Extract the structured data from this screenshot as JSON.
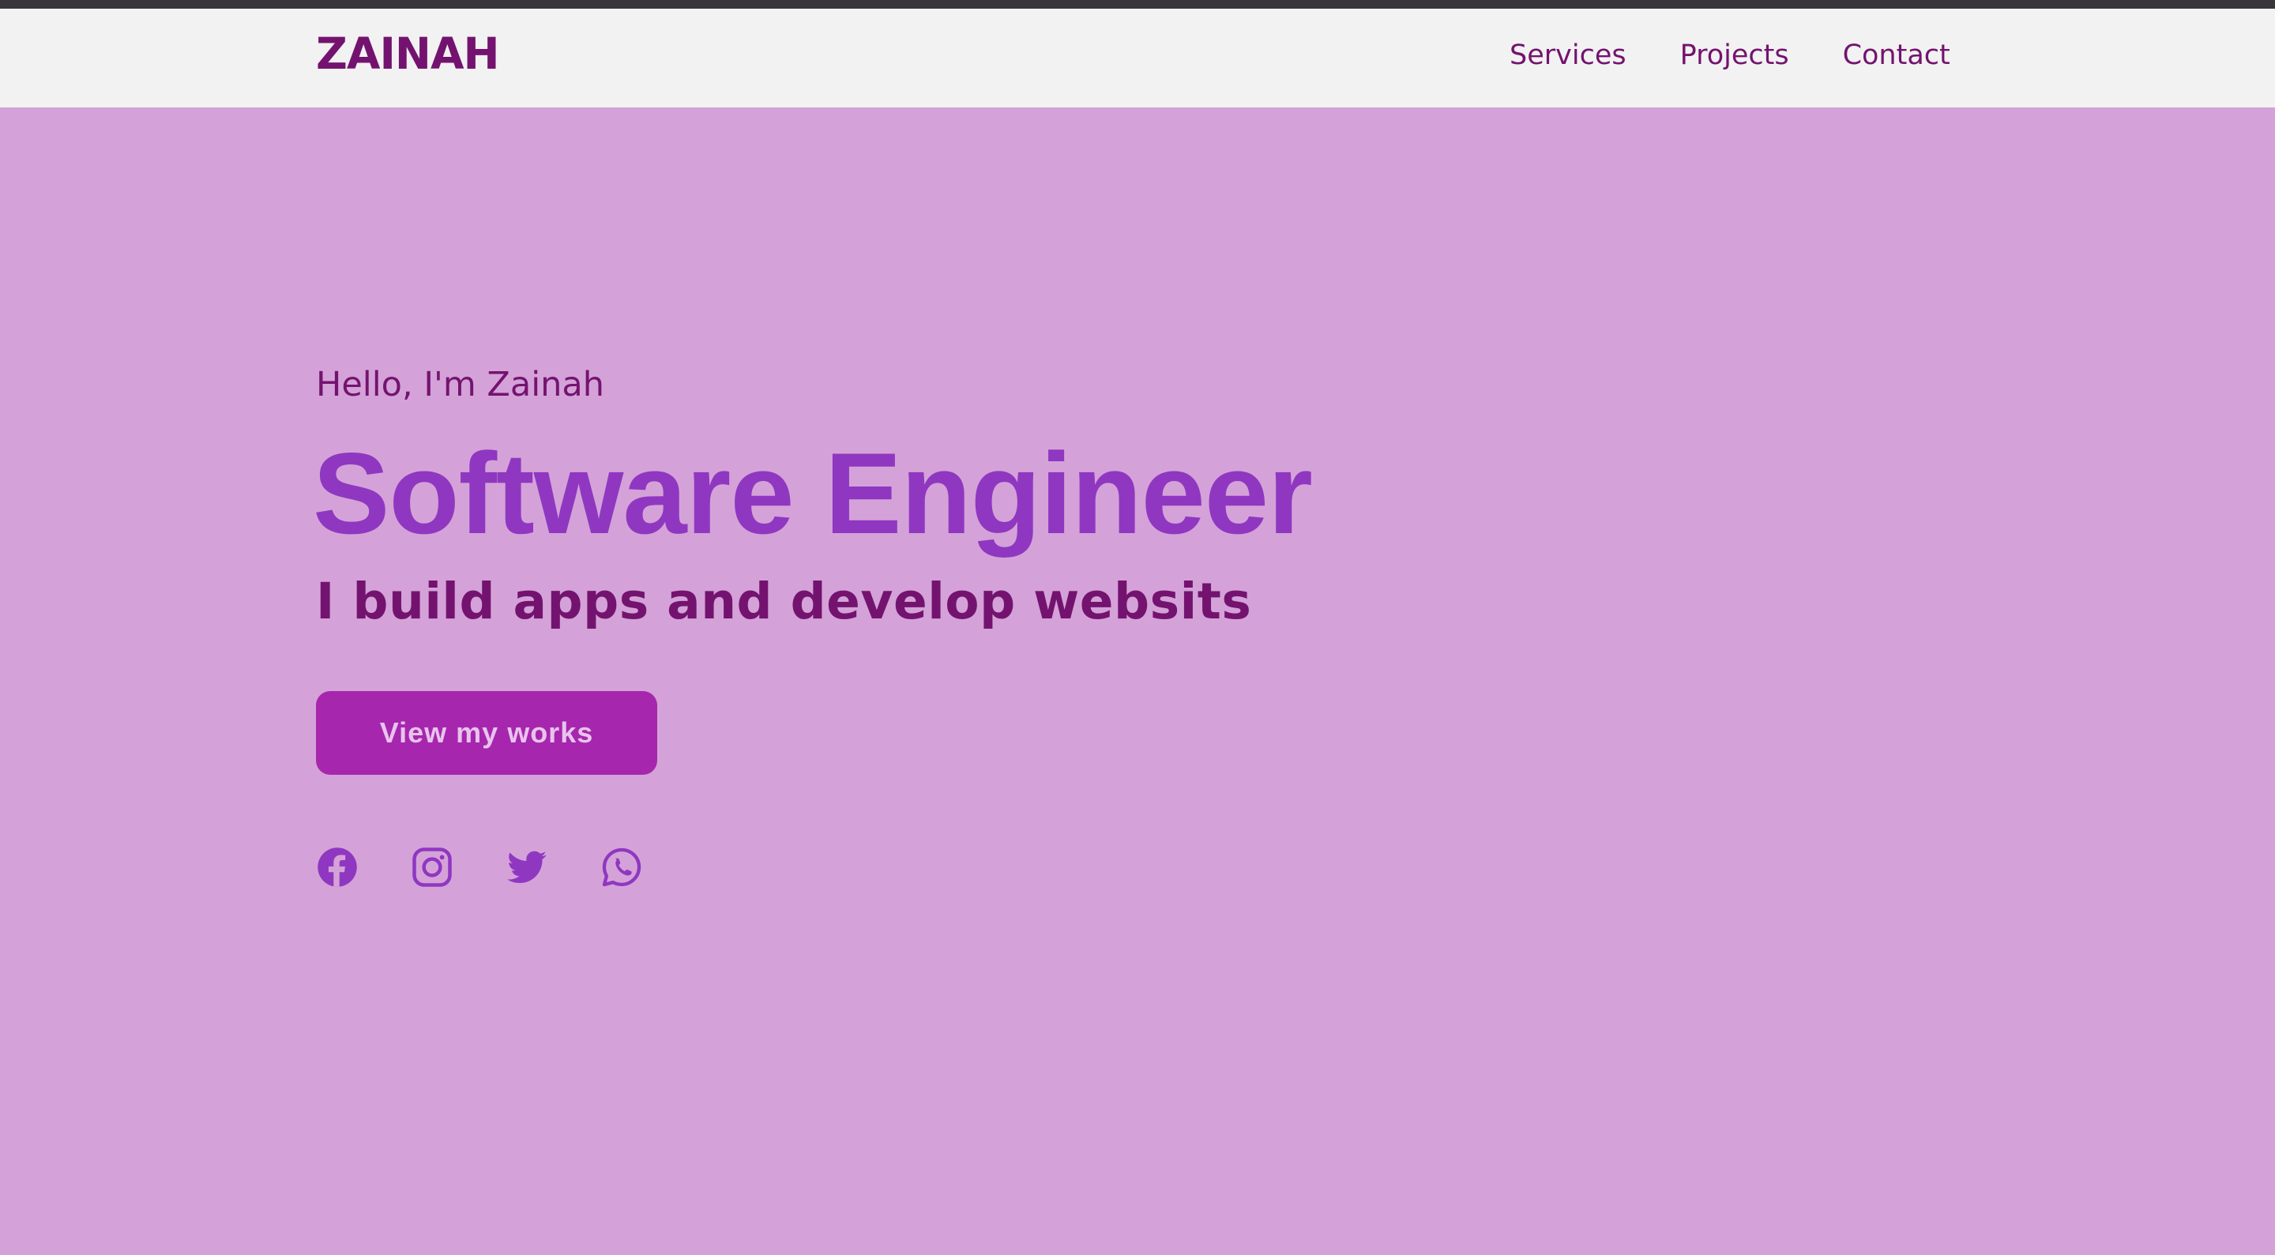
{
  "navbar": {
    "logo": "ZAINAH",
    "links": [
      {
        "label": "Services"
      },
      {
        "label": "Projects"
      },
      {
        "label": "Contact"
      }
    ]
  },
  "hero": {
    "greeting": "Hello, I'm Zainah",
    "title": "Software Engineer",
    "subtitle": "I build apps and develop websits",
    "cta_label": "View my works"
  },
  "socials": [
    {
      "icon": "facebook-icon"
    },
    {
      "icon": "instagram-icon"
    },
    {
      "icon": "twitter-icon"
    },
    {
      "icon": "whatsapp-icon"
    }
  ],
  "colors": {
    "background": "#d4a2d8",
    "navbar": "#f2f2f2",
    "brand_dark": "#74136f",
    "title": "#8f37c1",
    "button": "#a627ad",
    "button_text": "#e9c3ee",
    "icons": "#8f37c1"
  }
}
